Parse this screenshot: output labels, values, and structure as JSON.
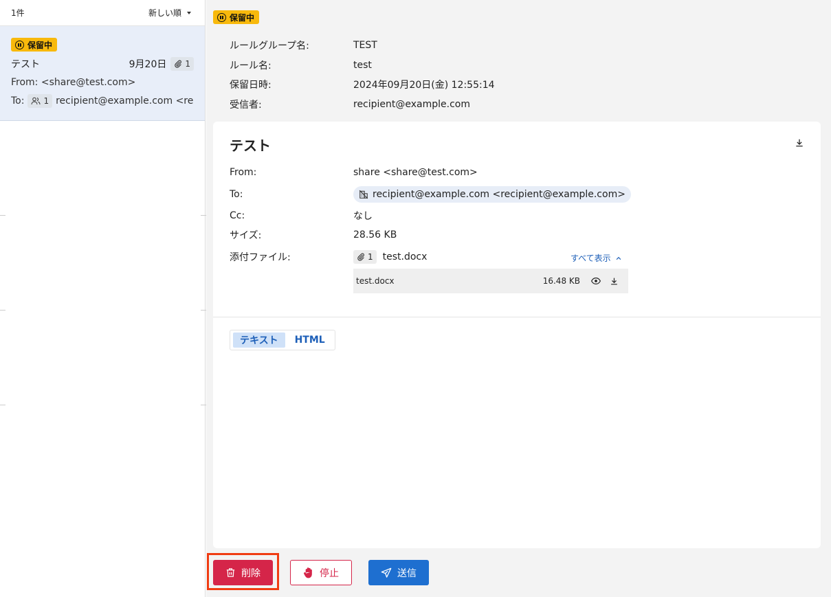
{
  "list": {
    "count_label": "1件",
    "sort_label": "新しい順",
    "item": {
      "status": "保留中",
      "subject": "テスト",
      "date": "9月20日",
      "attachment_count": "1",
      "from": "From: <share@test.com>",
      "to_label": "To:",
      "recipient_count": "1",
      "to_text": "recipient@example.com <rec..."
    }
  },
  "detail": {
    "status": "保留中",
    "info": [
      {
        "key": "ルールグループ名:",
        "value": "TEST"
      },
      {
        "key": "ルール名:",
        "value": "test"
      },
      {
        "key": "保留日時:",
        "value": "2024年09月20日(金) 12:55:14"
      },
      {
        "key": "受信者:",
        "value": "recipient@example.com"
      }
    ],
    "mail": {
      "subject": "テスト",
      "from_label": "From:",
      "from": "share <share@test.com>",
      "to_label": "To:",
      "to": "recipient@example.com <recipient@example.com>",
      "cc_label": "Cc:",
      "cc": "なし",
      "size_label": "サイズ:",
      "size": "28.56 KB",
      "attachments_label": "添付ファイル:",
      "attachment_count": "1",
      "attachment_summary": "test.docx",
      "show_all": "すべて表示",
      "attachments": [
        {
          "name": "test.docx",
          "size": "16.48 KB"
        }
      ]
    },
    "tabs": [
      "テキスト",
      "HTML"
    ],
    "active_tab": "テキスト"
  },
  "actions": {
    "delete": "削除",
    "stop": "停止",
    "send": "送信"
  },
  "colors": {
    "pending_badge": "#f8b90c",
    "delete": "#d52549",
    "send": "#1e6fd0",
    "highlight": "#f03c12",
    "link": "#1d5fb8"
  }
}
